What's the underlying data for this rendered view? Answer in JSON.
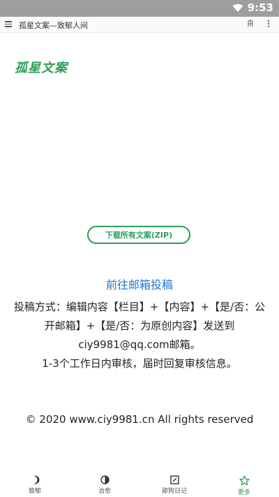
{
  "status_bar": {
    "time": "9:53"
  },
  "app_bar": {
    "title": "孤星文案—致郁人间"
  },
  "logo": {
    "text": "孤星文案"
  },
  "download_button": {
    "label": "下载所有文案(ZIP)"
  },
  "submit_link": {
    "label": "前往邮箱投稿"
  },
  "instructions": {
    "line1": "投稿方式：编辑内容【栏目】+【内容】+【是/否：公开邮箱】+【是/否：为原创内容】发送到ciy9981@qq.com邮箱。",
    "line2": "1-3个工作日内审核，届时回复审核信息。"
  },
  "footer": {
    "copyright": "© 2020 www.ciy9981.cn All rights reserved"
  },
  "bottom_nav": {
    "items": [
      {
        "label": "致郁",
        "icon": "moon-icon"
      },
      {
        "label": "治愈",
        "icon": "contrast-icon"
      },
      {
        "label": "舔狗日记",
        "icon": "edit-icon"
      },
      {
        "label": "更多",
        "icon": "star-icon"
      }
    ],
    "active_color": "#2e9e56"
  },
  "colors": {
    "accent": "#2e9e56",
    "link": "#1976d2",
    "status_bar": "#9e9e9e"
  }
}
